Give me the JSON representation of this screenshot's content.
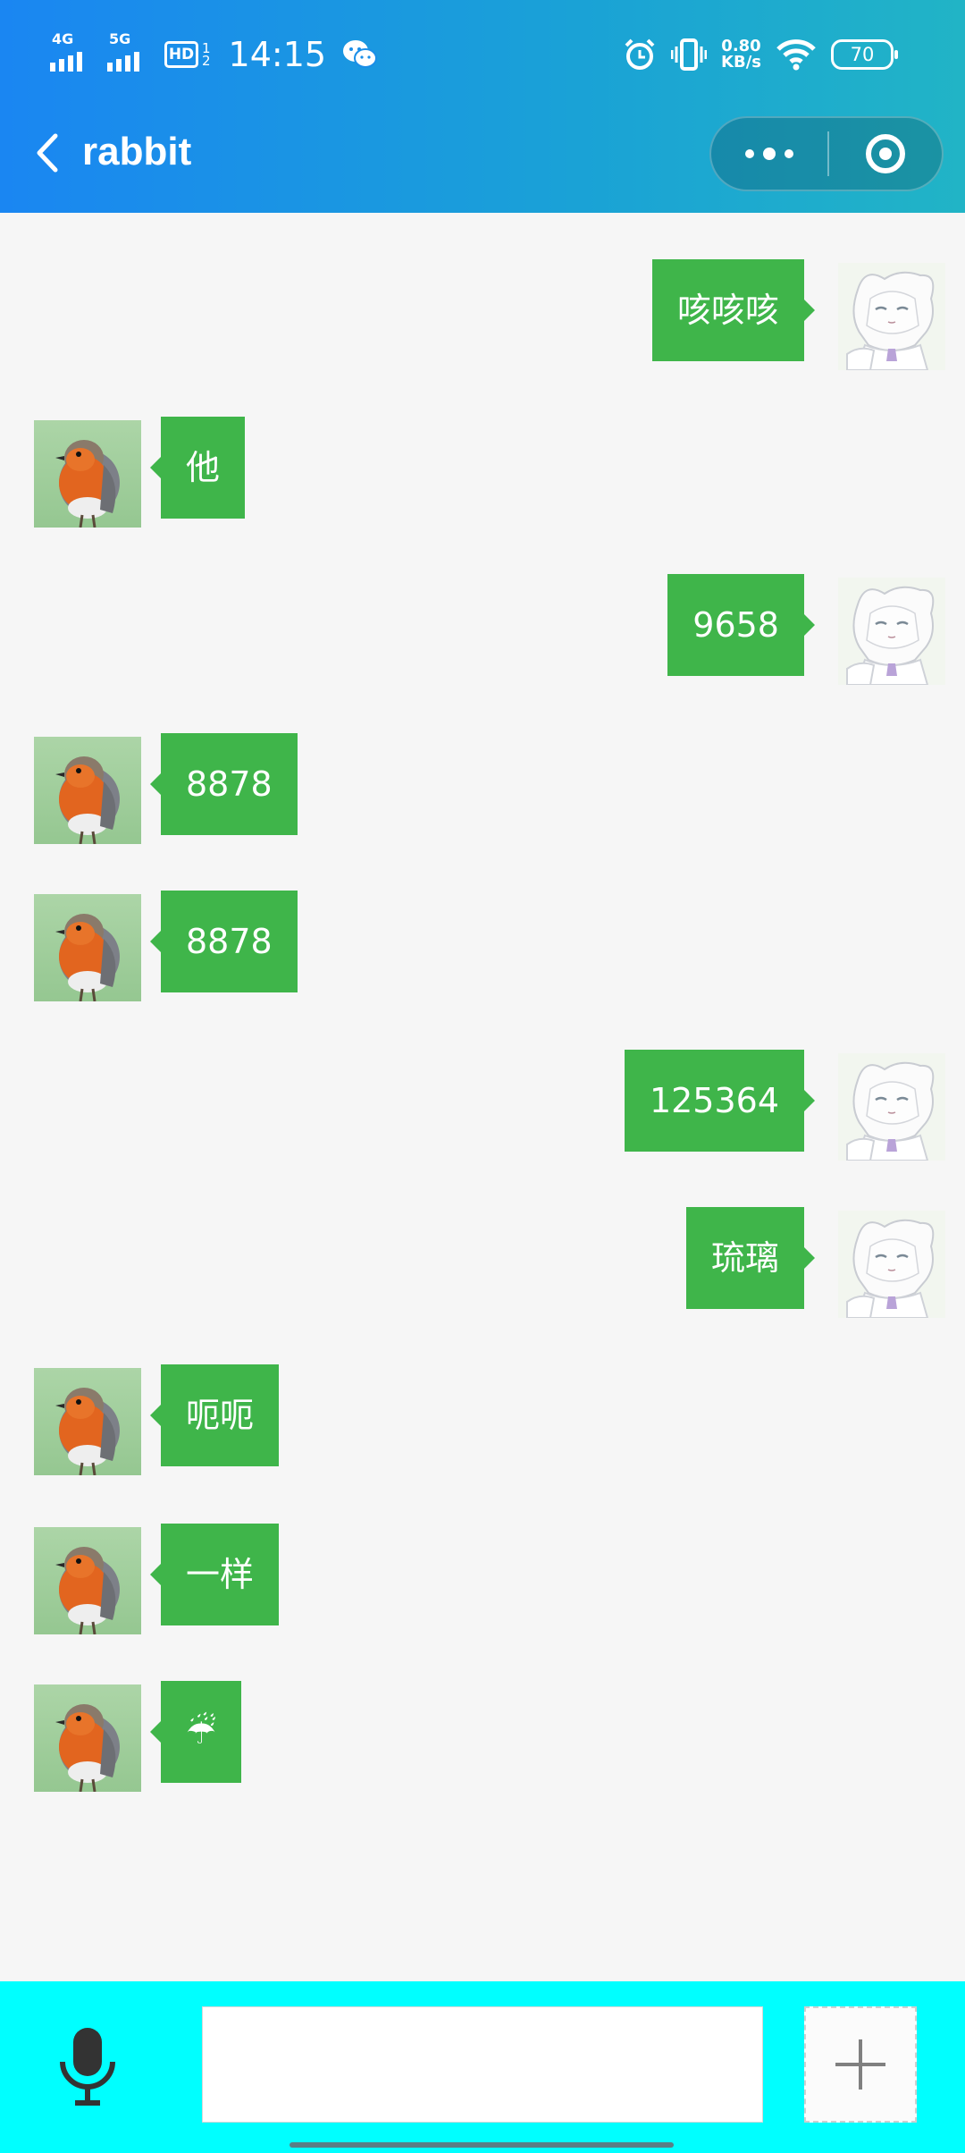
{
  "status_bar": {
    "network1": "4G",
    "network2": "5G",
    "hd": "HD",
    "hd_sub1": "1",
    "hd_sub2": "2",
    "time": "14:15",
    "speed_value": "0.80",
    "speed_unit": "KB/s",
    "battery": "70",
    "icons": [
      "wechat-icon",
      "alarm-icon",
      "vibrate-icon",
      "wifi-icon"
    ]
  },
  "header": {
    "title": "rabbit",
    "icons": [
      "back-icon",
      "more-icon",
      "close-miniprogram-icon"
    ]
  },
  "messages": [
    {
      "side": "right",
      "text": "咳咳咳",
      "avatar": "anime-avatar"
    },
    {
      "side": "left",
      "text": "他",
      "avatar": "robin-avatar"
    },
    {
      "side": "right",
      "text": "9658",
      "avatar": "anime-avatar"
    },
    {
      "side": "left",
      "text": "8878",
      "avatar": "robin-avatar"
    },
    {
      "side": "left",
      "text": "8878",
      "avatar": "robin-avatar"
    },
    {
      "side": "right",
      "text": "125364",
      "avatar": "anime-avatar"
    },
    {
      "side": "right",
      "text": "琉璃",
      "avatar": "anime-avatar"
    },
    {
      "side": "left",
      "text": "呃呃",
      "avatar": "robin-avatar"
    },
    {
      "side": "left",
      "text": "一样",
      "avatar": "robin-avatar"
    },
    {
      "side": "left",
      "text": "☔",
      "avatar": "robin-avatar"
    }
  ],
  "composer": {
    "input_value": "",
    "icons": [
      "microphone-icon",
      "plus-icon"
    ]
  },
  "colors": {
    "header_start": "#1a86f2",
    "header_end": "#21b4c6",
    "bubble": "#3fb54a",
    "bottom_bar": "#00ffff",
    "background": "#f6f6f6"
  }
}
